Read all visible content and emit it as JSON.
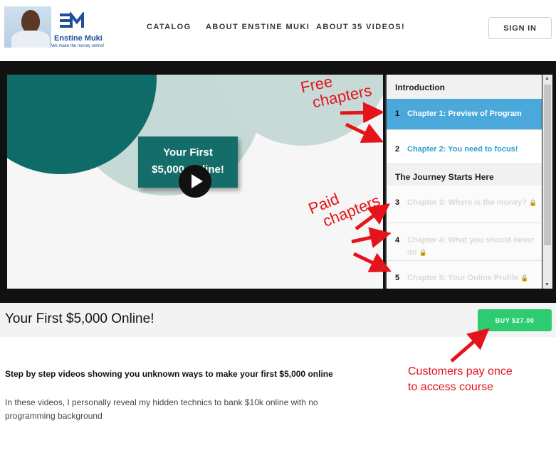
{
  "header": {
    "brand_name": "Enstine Muki",
    "brand_tagline": "We make the money online!",
    "nav": [
      "CATALOG",
      "ABOUT ENSTINE MUKI",
      "ABOUT 35 VIDEOS!"
    ],
    "sign_in": "SIGN IN"
  },
  "video": {
    "title_card_line1": "Your First",
    "title_card_line2": "$5,000 Online!"
  },
  "chapters": {
    "sections": [
      {
        "title": "Introduction"
      },
      {
        "title": "The Journey Starts Here"
      }
    ],
    "items": [
      {
        "num": "1",
        "label": "Chapter 1: Preview of Program",
        "state": "active"
      },
      {
        "num": "2",
        "label": "Chapter 2: You need to focus!",
        "state": "free"
      },
      {
        "num": "3",
        "label": "Chapter 3: Where is the money?",
        "state": "locked"
      },
      {
        "num": "4",
        "label": "Chapter 4: What you should never do",
        "state": "locked"
      },
      {
        "num": "5",
        "label": "Chapter 5: Your Online Profile",
        "state": "locked"
      }
    ]
  },
  "course": {
    "title": "Your First $5,000 Online!",
    "buy_label": "BUY $27.00",
    "subtitle": "Step by step videos showing you unknown ways to make your first $5,000 online",
    "description": "In these videos, I personally reveal my hidden technics to bank $10k online with no programming background"
  },
  "annotations": {
    "free": [
      "Free",
      "chapters"
    ],
    "paid": [
      "Paid",
      "chapters"
    ],
    "pay": [
      "Customers pay once",
      "to access course"
    ]
  },
  "colors": {
    "accent_blue": "#4aa8db",
    "buy_green": "#2ecc71",
    "annotation_red": "#e5131a",
    "video_teal": "#0f6b68"
  }
}
